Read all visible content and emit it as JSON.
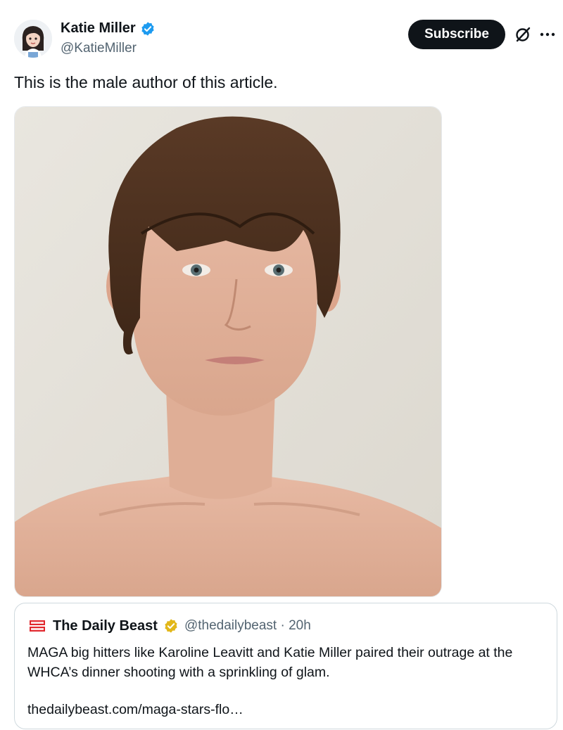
{
  "tweet": {
    "author": {
      "name": "Katie Miller",
      "handle": "@KatieMiller",
      "verified": true,
      "avatar_icon": "cartoon-avatar-icon",
      "badge_color": "#1d9bf0"
    },
    "actions": {
      "subscribe_label": "Subscribe",
      "grok_icon": "grok-icon",
      "more_icon": "more-dots-icon"
    },
    "text": "This is the male author of this article.",
    "media": {
      "type": "photo",
      "description_icon": "portrait-photo"
    }
  },
  "quote": {
    "logo_icon": "daily-beast-logo",
    "name": "The Daily Beast",
    "verified_badge": "gold",
    "badge_color": "#e2b719",
    "handle_time": "@thedailybeast · 20h",
    "text": "MAGA big hitters like Karoline Leavitt and Katie Miller paired their outrage at the WHCA’s dinner shooting with a sprinkling of glam.",
    "link": "thedailybeast.com/maga-stars-flo…"
  },
  "colors": {
    "text_primary": "#0f1419",
    "text_secondary": "#536471",
    "border": "#cfd9de",
    "button_bg": "#0f1419"
  }
}
